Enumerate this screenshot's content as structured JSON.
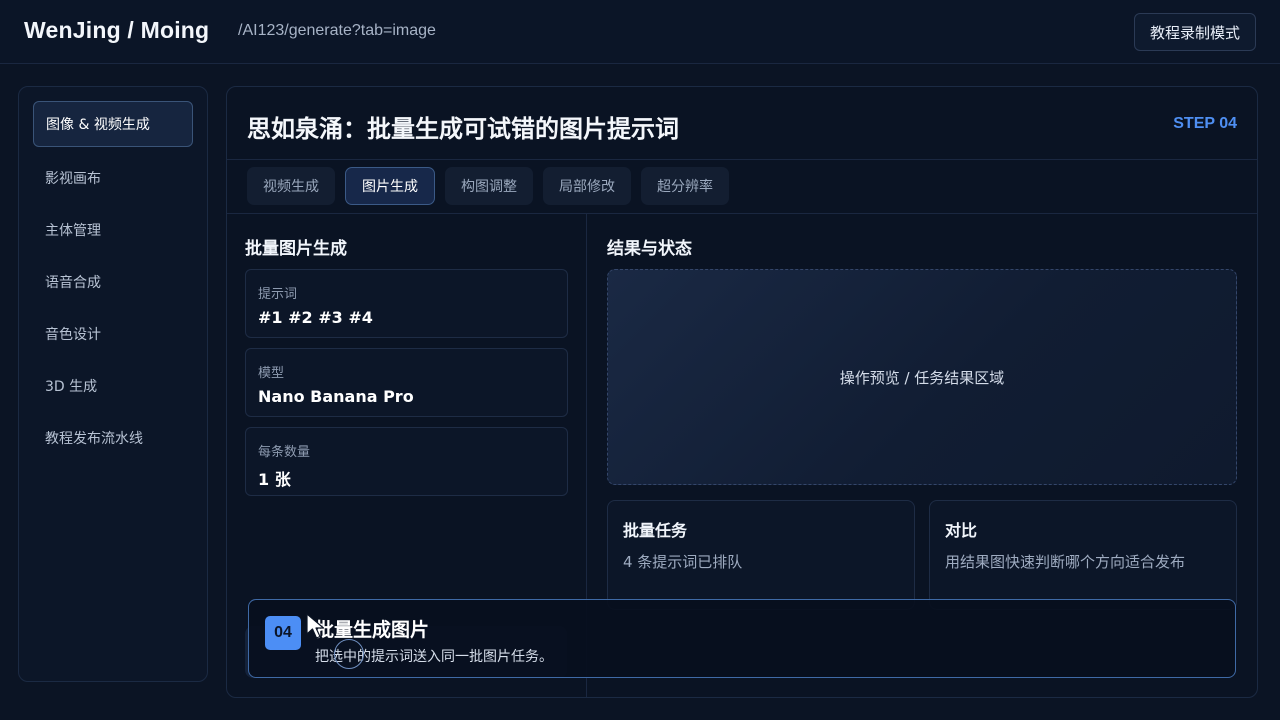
{
  "header": {
    "brand": "WenJing / Moing",
    "url": "/AI123/generate?tab=image",
    "mode_button": "教程录制模式"
  },
  "sidebar": {
    "items": [
      {
        "label": "图像 & 视频生成",
        "active": true
      },
      {
        "label": "影视画布",
        "active": false
      },
      {
        "label": "主体管理",
        "active": false
      },
      {
        "label": "语音合成",
        "active": false
      },
      {
        "label": "音色设计",
        "active": false
      },
      {
        "label": "3D 生成",
        "active": false
      },
      {
        "label": "教程发布流水线",
        "active": false
      }
    ]
  },
  "main": {
    "title": "思如泉涌：批量生成可试错的图片提示词",
    "step": "STEP 04",
    "tabs": [
      {
        "label": "视频生成",
        "active": false
      },
      {
        "label": "图片生成",
        "active": true
      },
      {
        "label": "构图调整",
        "active": false
      },
      {
        "label": "局部修改",
        "active": false
      },
      {
        "label": "超分辨率",
        "active": false
      }
    ],
    "left": {
      "title": "批量图片生成",
      "fields": [
        {
          "label": "提示词",
          "value": "#1 #2 #3 #4"
        },
        {
          "label": "模型",
          "value": "Nano Banana Pro"
        },
        {
          "label": "每条数量",
          "value": "1 张"
        }
      ]
    },
    "right": {
      "title": "结果与状态",
      "preview_text": "操作预览 / 任务结果区域",
      "cards": [
        {
          "title": "批量任务",
          "text": "4 条提示词已排队"
        },
        {
          "title": "对比",
          "text": "用结果图快速判断哪个方向适合发布"
        }
      ]
    }
  },
  "hint": {
    "number": "04",
    "title": "批量生成图片",
    "text": "把选中的提示词送入同一批图片任务。"
  },
  "colors": {
    "background": "#0b1424",
    "accent": "#4c8ef5",
    "panel_border": "#1b2a43"
  },
  "icons": {
    "cursor": "mouse-pointer-icon"
  }
}
